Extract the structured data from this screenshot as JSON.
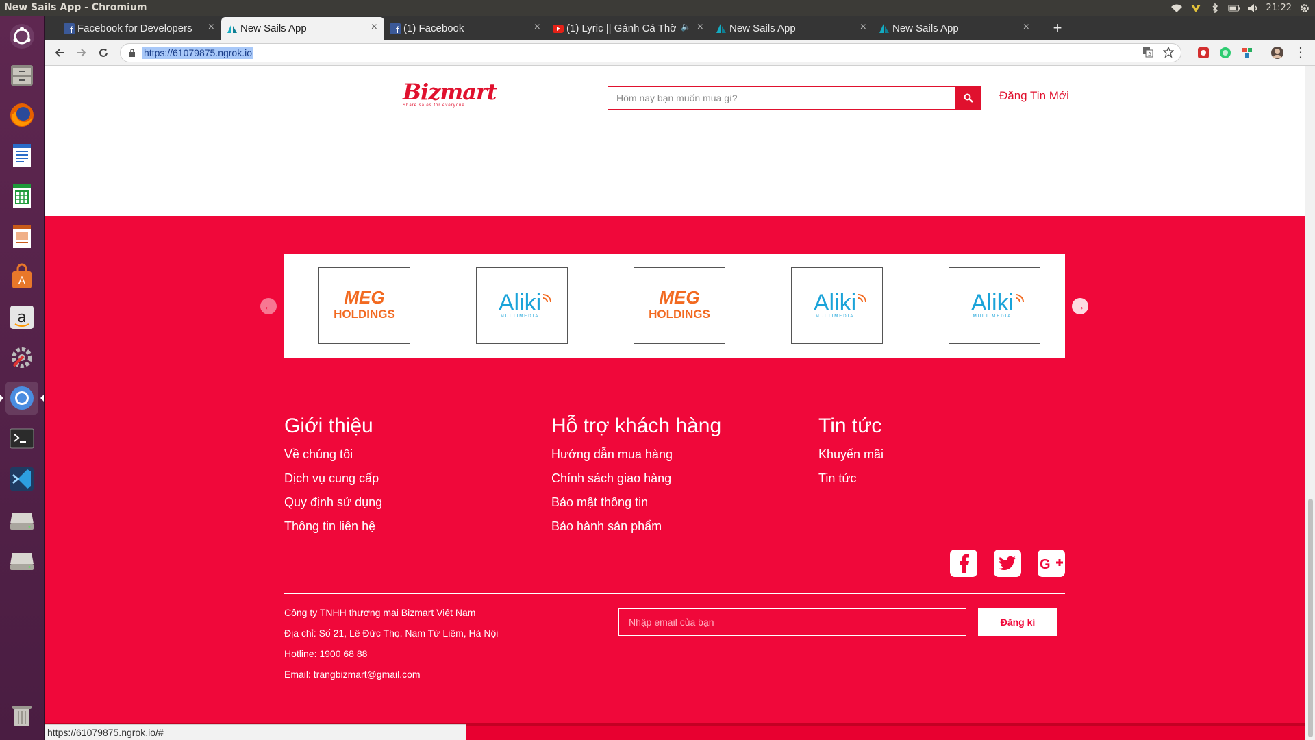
{
  "os": {
    "window_title": "New Sails App - Chromium",
    "clock": "21:22"
  },
  "browser": {
    "tabs": [
      {
        "label": "Facebook for Developers",
        "favicon": "facebook-icon"
      },
      {
        "label": "New Sails App",
        "favicon": "sails-icon"
      },
      {
        "label": "(1) Facebook",
        "favicon": "facebook-icon"
      },
      {
        "label": "(1) Lyric || Gánh Cá Thờ",
        "favicon": "youtube-icon"
      },
      {
        "label": "New Sails App",
        "favicon": "sails-icon"
      },
      {
        "label": "New Sails App",
        "favicon": "sails-icon"
      }
    ],
    "active_tab": 1,
    "url": "https://61079875.ngrok.io",
    "status_url": "https://61079875.ngrok.io/#"
  },
  "site": {
    "header": {
      "search_placeholder": "Hôm nay bạn muốn mua gì?",
      "post_link": "Đăng Tin Mới",
      "logo_text": "Bizmart",
      "logo_tagline": "Share sales for everyone"
    },
    "partners": [
      "MEG HOLDINGS",
      "Aliki",
      "MEG HOLDINGS",
      "Aliki",
      "Aliki"
    ],
    "partner_logos": {
      "meg_line1": "MEG",
      "meg_line2": "HOLDINGS",
      "aliki_name": "Aliki",
      "aliki_sub": "MULTIMEDIA"
    },
    "footer": {
      "columns": [
        {
          "title": "Giới thiệu",
          "links": [
            "Về chúng tôi",
            "Dịch vụ cung cấp",
            "Quy định sử dụng",
            "Thông tin liên hệ"
          ]
        },
        {
          "title": "Hỗ trợ khách hàng",
          "links": [
            "Hướng dẫn mua hàng",
            "Chính sách giao hàng",
            "Bảo mật thông tin",
            "Bảo hành sản phẩm"
          ]
        },
        {
          "title": "Tin tức",
          "links": [
            "Khuyến mãi",
            "Tin tức"
          ]
        }
      ],
      "company": {
        "name": "Công ty TNHH thương mại Bizmart Việt Nam",
        "address": "Địa chỉ: Số 21, Lê Đức Thọ, Nam Từ Liêm, Hà Nội",
        "hotline": "Hotline: 1900 68 88",
        "email": "Email: trangbizmart@gmail.com"
      },
      "newsletter_placeholder": "Nhập email của bạn",
      "subscribe_label": "Đăng kí",
      "socials": [
        "facebook-icon",
        "twitter-icon",
        "google-plus-icon"
      ]
    }
  },
  "colors": {
    "brand_red": "#f0083a",
    "header_red": "#e0112e",
    "meg_orange": "#f26a21",
    "aliki_blue": "#1aa3d9"
  }
}
